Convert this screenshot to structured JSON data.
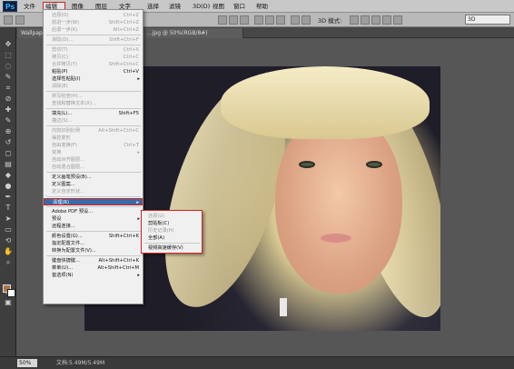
{
  "app": {
    "logo": "Ps"
  },
  "menubar": {
    "items": [
      "文件(F)",
      "编辑(E)",
      "图像(I)",
      "图层(L)",
      "文字(Y)",
      "选择(S)",
      "滤镜(T)",
      "3D(D)",
      "视图(V)",
      "窗口(W)",
      "帮助(H)"
    ]
  },
  "options": {
    "mode_label": "3D 模式:",
    "mode_value": "3D"
  },
  "tabs": [
    {
      "label": "Wallpap..."
    },
    {
      "label": "...jpg @ 50%(RGB/8#)"
    }
  ],
  "edit_menu": {
    "items": [
      {
        "label": "还原(O)",
        "shortcut": "Ctrl+Z",
        "disabled": true
      },
      {
        "label": "前进一步(W)",
        "shortcut": "Shift+Ctrl+Z",
        "disabled": true
      },
      {
        "label": "后退一步(K)",
        "shortcut": "Alt+Ctrl+Z",
        "disabled": true
      },
      {
        "sep": true
      },
      {
        "label": "渐隐(D)...",
        "shortcut": "Shift+Ctrl+F",
        "disabled": true
      },
      {
        "sep": true
      },
      {
        "label": "剪切(T)",
        "shortcut": "Ctrl+X",
        "disabled": true
      },
      {
        "label": "拷贝(C)",
        "shortcut": "Ctrl+C",
        "disabled": true
      },
      {
        "label": "合并拷贝(Y)",
        "shortcut": "Shift+Ctrl+C",
        "disabled": true
      },
      {
        "label": "粘贴(P)",
        "shortcut": "Ctrl+V",
        "disabled": false
      },
      {
        "label": "选择性粘贴(I)",
        "shortcut": "",
        "disabled": false,
        "submenu": true
      },
      {
        "label": "清除(E)",
        "shortcut": "",
        "disabled": true
      },
      {
        "sep": true
      },
      {
        "label": "拼写检查(H)...",
        "shortcut": "",
        "disabled": true
      },
      {
        "label": "查找和替换文本(X)...",
        "shortcut": "",
        "disabled": true
      },
      {
        "sep": true
      },
      {
        "label": "填充(L)...",
        "shortcut": "Shift+F5",
        "disabled": false
      },
      {
        "label": "描边(S)...",
        "shortcut": "",
        "disabled": true
      },
      {
        "sep": true
      },
      {
        "label": "内容识别比例",
        "shortcut": "Alt+Shift+Ctrl+C",
        "disabled": true
      },
      {
        "label": "操控变形",
        "shortcut": "",
        "disabled": true
      },
      {
        "label": "自由变换(F)",
        "shortcut": "Ctrl+T",
        "disabled": true
      },
      {
        "label": "变换",
        "shortcut": "",
        "disabled": true,
        "submenu": true
      },
      {
        "label": "自动对齐图层...",
        "shortcut": "",
        "disabled": true
      },
      {
        "label": "自动混合图层...",
        "shortcut": "",
        "disabled": true
      },
      {
        "sep": true
      },
      {
        "label": "定义画笔预设(B)...",
        "shortcut": "",
        "disabled": false
      },
      {
        "label": "定义图案...",
        "shortcut": "",
        "disabled": false
      },
      {
        "label": "定义自定形状...",
        "shortcut": "",
        "disabled": true
      },
      {
        "sep": true
      },
      {
        "label": "清理(R)",
        "shortcut": "",
        "disabled": false,
        "submenu": true,
        "highlight": true
      },
      {
        "sep": true
      },
      {
        "label": "Adobe PDF 预设...",
        "shortcut": "",
        "disabled": false
      },
      {
        "label": "预设",
        "shortcut": "",
        "disabled": false,
        "submenu": true
      },
      {
        "label": "远程连接...",
        "shortcut": "",
        "disabled": false
      },
      {
        "sep": true
      },
      {
        "label": "颜色设置(G)...",
        "shortcut": "Shift+Ctrl+K",
        "disabled": false
      },
      {
        "label": "指定配置文件...",
        "shortcut": "",
        "disabled": false
      },
      {
        "label": "转换为配置文件(V)...",
        "shortcut": "",
        "disabled": false
      },
      {
        "sep": true
      },
      {
        "label": "键盘快捷键...",
        "shortcut": "Alt+Shift+Ctrl+K",
        "disabled": false
      },
      {
        "label": "菜单(U)...",
        "shortcut": "Alt+Shift+Ctrl+M",
        "disabled": false
      },
      {
        "label": "首选项(N)",
        "shortcut": "",
        "disabled": false,
        "submenu": true
      }
    ]
  },
  "purge_submenu": {
    "items": [
      {
        "label": "还原(U)",
        "disabled": true
      },
      {
        "label": "剪贴板(C)",
        "disabled": false
      },
      {
        "label": "历史记录(H)",
        "disabled": true
      },
      {
        "label": "全部(A)",
        "disabled": false
      },
      {
        "sep": true
      },
      {
        "label": "视频高速缓存(V)",
        "disabled": false
      }
    ]
  },
  "status": {
    "zoom": "50%",
    "doc": "文档:5.49M/5.49M"
  },
  "colors": {
    "foreground": "#a97548",
    "background": "#ffffff",
    "highlight": "#3b6aa9",
    "red_outline": "#d2231f"
  },
  "icons": [
    "move-icon",
    "marquee-icon",
    "lasso-icon",
    "quick-select-icon",
    "crop-icon",
    "eyedropper-icon",
    "healing-icon",
    "brush-icon",
    "stamp-icon",
    "history-brush-icon",
    "eraser-icon",
    "gradient-icon",
    "blur-icon",
    "dodge-icon",
    "pen-icon",
    "type-icon",
    "path-select-icon",
    "shape-icon",
    "3d-rotate-icon",
    "hand-icon",
    "zoom-icon",
    "quick-mask-icon",
    "screen-mode-icon"
  ]
}
